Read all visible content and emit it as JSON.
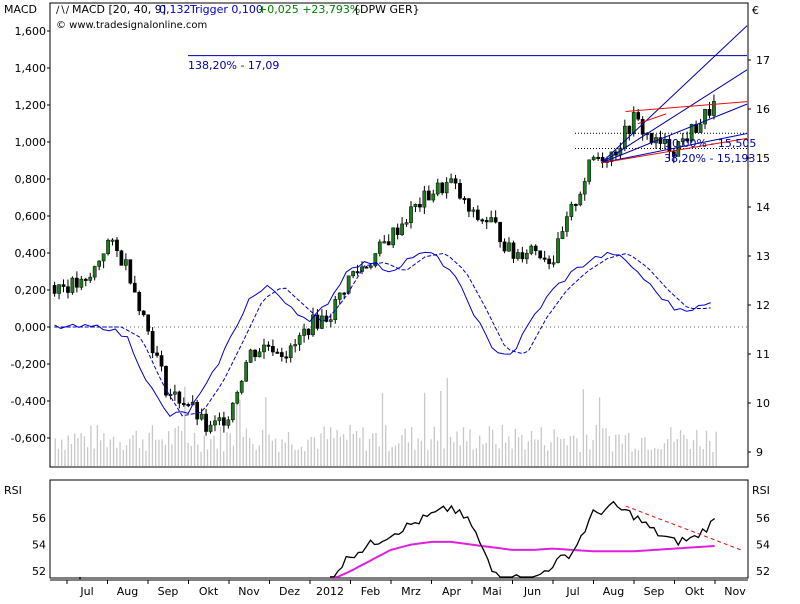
{
  "header": {
    "panel_label": "MACD",
    "indicator_text": "MACD [20, 40, 9]",
    "macd_value": "0,132",
    "trigger_text": "Trigger 0,100",
    "change_text": "+0,025 +23,793%",
    "symbol_text": "{DPW GER}",
    "copyright": "© www.tradesignalonline.com",
    "currency": "€"
  },
  "fib_labels": {
    "level_138": "138,20% - 17,09",
    "level_50": "50,00% - 15,505",
    "level_38": "38,20% - 15,193"
  },
  "colors": {
    "candle_up": "#1e7a1e",
    "candle_down": "#000000",
    "macd_line": "#0000cc",
    "fib_line": "#0000aa",
    "channel_red": "#e01010",
    "rsi_line": "#000000",
    "rsi_ma": "#e020e0",
    "volume": "#c8c8c8",
    "change_text": "#008000"
  },
  "chart_data": [
    {
      "type": "line",
      "panel": "price-macd",
      "left_axis": {
        "ticks": [
          "1,600",
          "1,400",
          "1,200",
          "1,000",
          "0,800",
          "0,600",
          "0,400",
          "0,200",
          "0,000",
          "-0,200",
          "-0,400",
          "-0,600"
        ],
        "range": [
          -0.72,
          1.62
        ]
      },
      "right_axis": {
        "ticks": [
          "17",
          "16",
          "15",
          "14",
          "13",
          "12",
          "11",
          "10",
          "9"
        ],
        "range": [
          8.9,
          17.4
        ]
      },
      "x_ticks": [
        "Jul",
        "Aug",
        "Sep",
        "Okt",
        "Nov",
        "Dez",
        "2012",
        "Feb",
        "Mrz",
        "Apr",
        "Mai",
        "Jun",
        "Jul",
        "Aug",
        "Sep",
        "Okt",
        "Nov"
      ],
      "price_series_months": [
        0,
        0.5,
        1,
        1.5,
        2,
        2.5,
        3,
        3.5,
        4,
        4.5,
        5,
        5.5,
        6,
        6.5,
        7,
        7.5,
        8,
        8.5,
        9,
        9.5,
        10,
        10.5,
        11,
        11.5,
        12,
        12.5,
        13,
        13.5,
        14,
        14.5,
        15,
        15.5
      ],
      "price_values": [
        12.4,
        13.3,
        12.8,
        11.5,
        10.2,
        10.0,
        9.4,
        9.8,
        11.0,
        11.2,
        11.0,
        11.6,
        11.8,
        12.6,
        12.9,
        13.4,
        13.9,
        14.3,
        14.5,
        13.8,
        13.7,
        13.0,
        13.2,
        12.9,
        14.0,
        15.0,
        15.1,
        15.8,
        15.3,
        15.2,
        15.6,
        16.1
      ],
      "macd_values": [
        0.0,
        0.0,
        -0.06,
        -0.3,
        -0.48,
        -0.46,
        -0.3,
        -0.08,
        0.15,
        0.22,
        0.12,
        0.02,
        0.15,
        0.33,
        0.35,
        0.3,
        0.38,
        0.4,
        0.3,
        0.1,
        -0.12,
        -0.15,
        0.05,
        0.2,
        0.3,
        0.37,
        0.4,
        0.32,
        0.2,
        0.1,
        0.1,
        0.132
      ],
      "fib_levels": [
        {
          "label": "138,20% - 17,09",
          "value": 17.09
        },
        {
          "label": "50,00% - 15,505",
          "value": 15.505
        },
        {
          "label": "38,20% - 15,193",
          "value": 15.193
        }
      ]
    },
    {
      "type": "line",
      "panel": "rsi",
      "title": "RSI",
      "axis": {
        "ticks": [
          "56",
          "54",
          "52"
        ],
        "range": [
          51.2,
          57.8
        ]
      },
      "rsi_series_months": [
        6,
        6.5,
        7,
        7.5,
        8,
        8.5,
        9,
        9.5,
        10,
        10.5,
        11,
        11.5,
        12,
        12.5,
        13,
        13.5,
        14,
        14.5,
        15,
        15.5
      ],
      "rsi_values": [
        51.5,
        53.2,
        54.0,
        54.8,
        55.5,
        56.2,
        56.8,
        55.5,
        52.0,
        51.5,
        51.3,
        52.5,
        53.5,
        56.3,
        56.9,
        56.2,
        55.0,
        54.2,
        54.5,
        55.8
      ],
      "rsi_ma_values": [
        51.3,
        52.0,
        52.8,
        53.6,
        54.0,
        54.2,
        54.2,
        54.0,
        53.8,
        53.6,
        53.6,
        53.7,
        53.6,
        53.5,
        53.5,
        53.5,
        53.6,
        53.7,
        53.8,
        53.9
      ]
    }
  ]
}
